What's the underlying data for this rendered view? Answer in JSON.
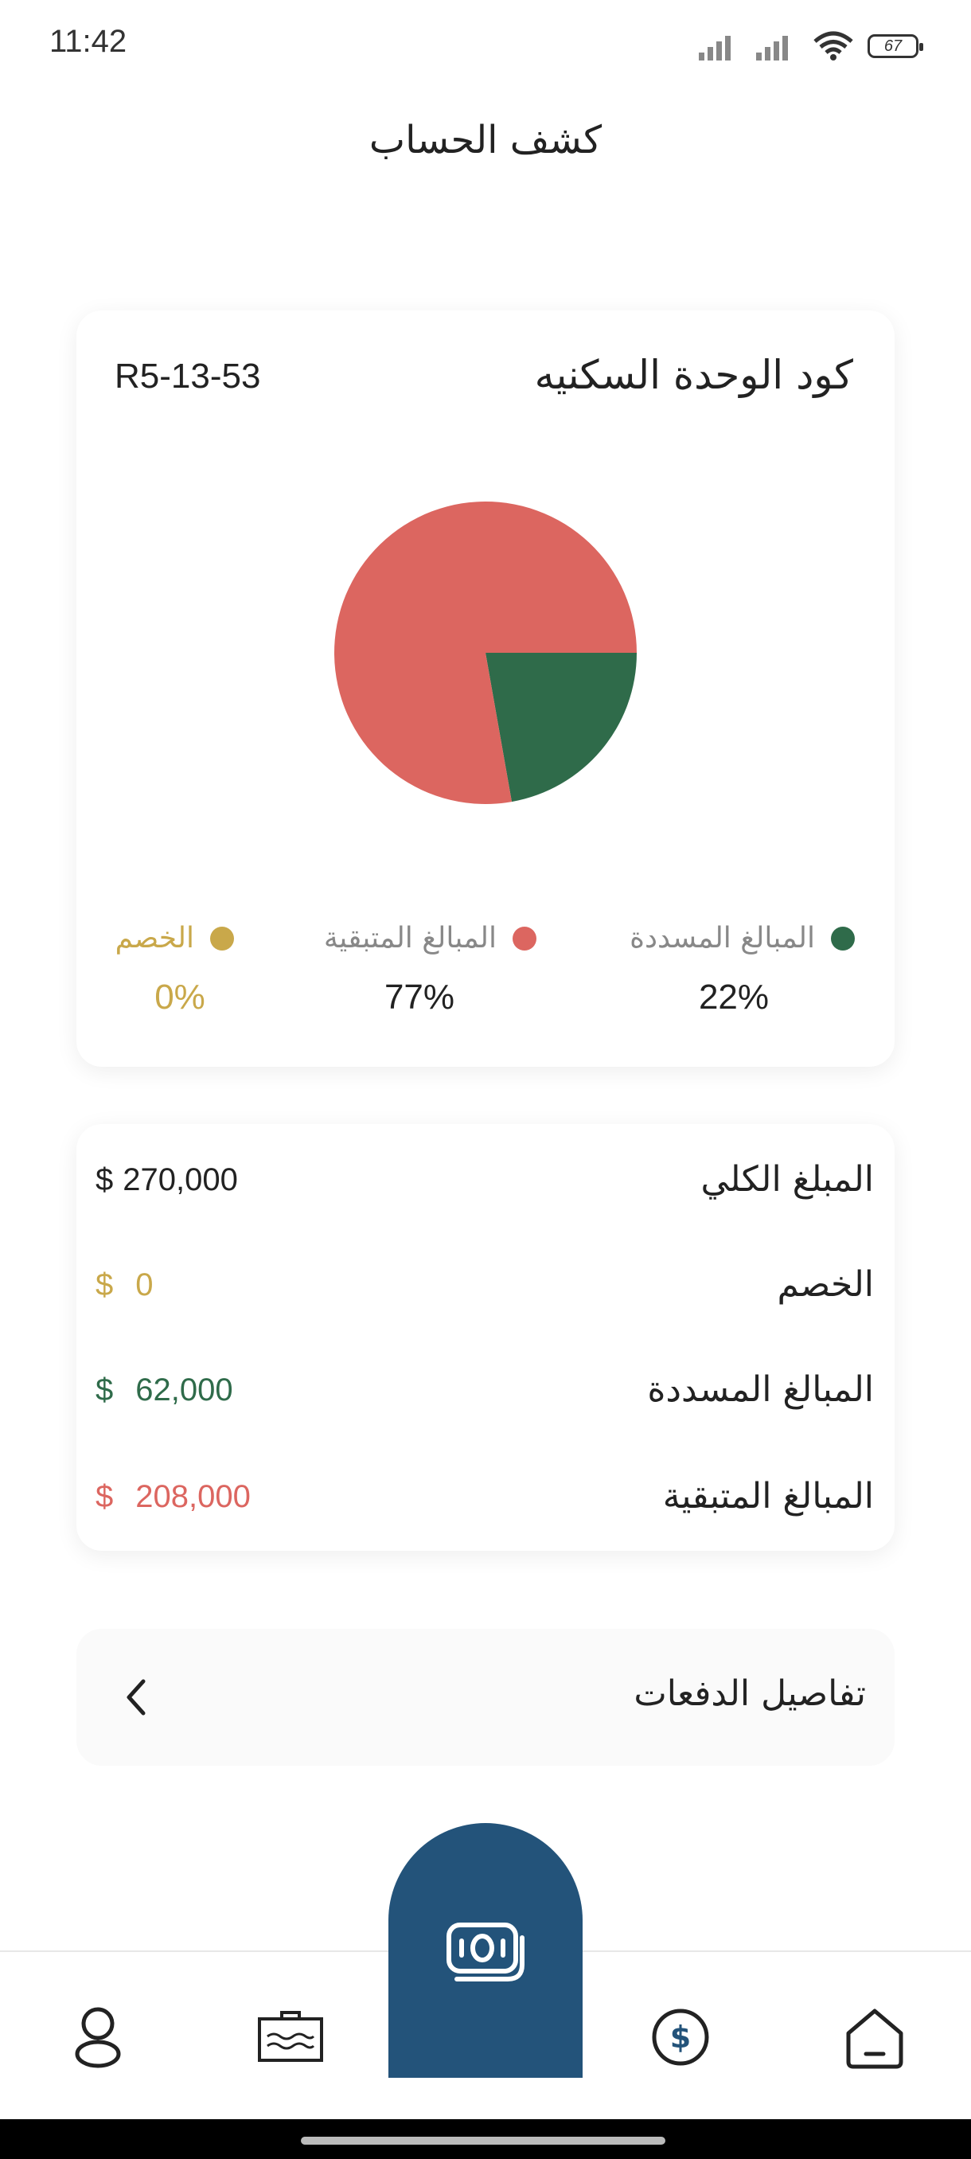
{
  "status_bar": {
    "time": "11:42",
    "battery": "67"
  },
  "header": {
    "title": "كشف الحساب"
  },
  "unit_card": {
    "label": "كود الوحدة السكنيه",
    "code": "R5-13-53",
    "legend": [
      {
        "label": "المبالغ المسددة",
        "percent": "22%",
        "color": "#2f6b4a"
      },
      {
        "label": "المبالغ المتبقية",
        "percent": "77%",
        "color": "#dc6660"
      },
      {
        "label": "الخصم",
        "percent": "0%",
        "color": "#c9a84a"
      }
    ]
  },
  "chart_data": {
    "type": "pie",
    "slices": [
      {
        "name": "المبالغ المسددة",
        "value": 22,
        "color": "#2f6b4a"
      },
      {
        "name": "المبالغ المتبقية",
        "value": 77,
        "color": "#dc6660"
      },
      {
        "name": "الخصم",
        "value": 0,
        "color": "#c9a84a"
      }
    ]
  },
  "totals": [
    {
      "label": "المبلغ الكلي",
      "currency": "$",
      "value": "270,000",
      "color": "#222222"
    },
    {
      "label": "الخصم",
      "currency": "$",
      "value": "0",
      "color": "#c9a84a"
    },
    {
      "label": "المبالغ المسددة",
      "currency": "$",
      "value": "62,000",
      "color": "#2f6b4a"
    },
    {
      "label": "المبالغ المتبقية",
      "currency": "$",
      "value": "208,000",
      "color": "#dc6660"
    }
  ],
  "payments": {
    "label": "تفاصيل الدفعات"
  },
  "nav": {
    "items": [
      "home-icon",
      "dollar-icon",
      "money-icon",
      "id-card-icon",
      "profile-icon"
    ],
    "active_color": "#23537a"
  }
}
